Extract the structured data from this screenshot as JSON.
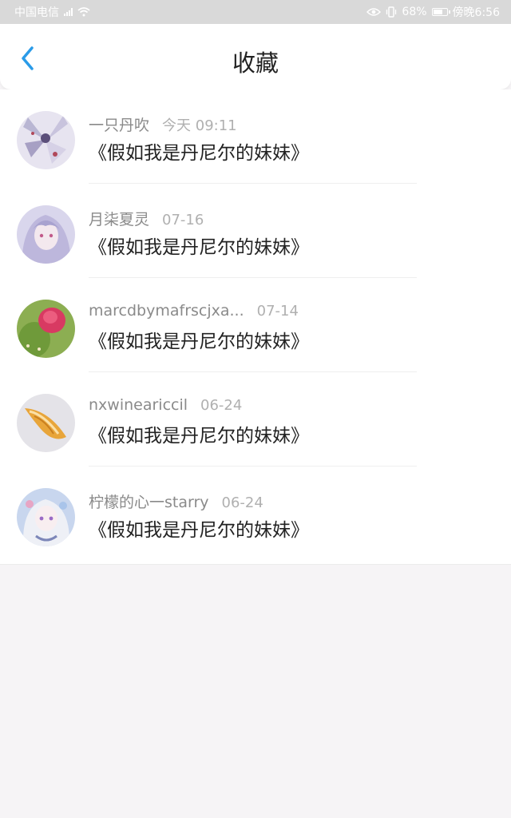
{
  "status_bar": {
    "carrier": "中国电信",
    "battery": "68%",
    "time": "傍晚6:56"
  },
  "header": {
    "title": "收藏"
  },
  "favorites": [
    {
      "author": "一只丹吹",
      "time": "今天 09:11",
      "title": "《假如我是丹尼尔的妹妹》",
      "avatar": "winged-figure-avatar"
    },
    {
      "author": "月柒夏灵",
      "time": "07-16",
      "title": "《假如我是丹尼尔的妹妹》",
      "avatar": "anime-girl-avatar"
    },
    {
      "author": "marcdbymafrscjxa...",
      "time": "07-14",
      "title": "《假如我是丹尼尔的妹妹》",
      "avatar": "cactus-flower-avatar"
    },
    {
      "author": "nxwineariccil",
      "time": "06-24",
      "title": "《假如我是丹尼尔的妹妹》",
      "avatar": "seashell-avatar"
    },
    {
      "author": "柠檬的心一starry",
      "time": "06-24",
      "title": "《假如我是丹尼尔的妹妹》",
      "avatar": "anime-doll-avatar"
    }
  ],
  "colors": {
    "accent": "#2a9be8",
    "status_bar_bg": "#d9d9d9",
    "page_bg": "#f6f4f6"
  }
}
